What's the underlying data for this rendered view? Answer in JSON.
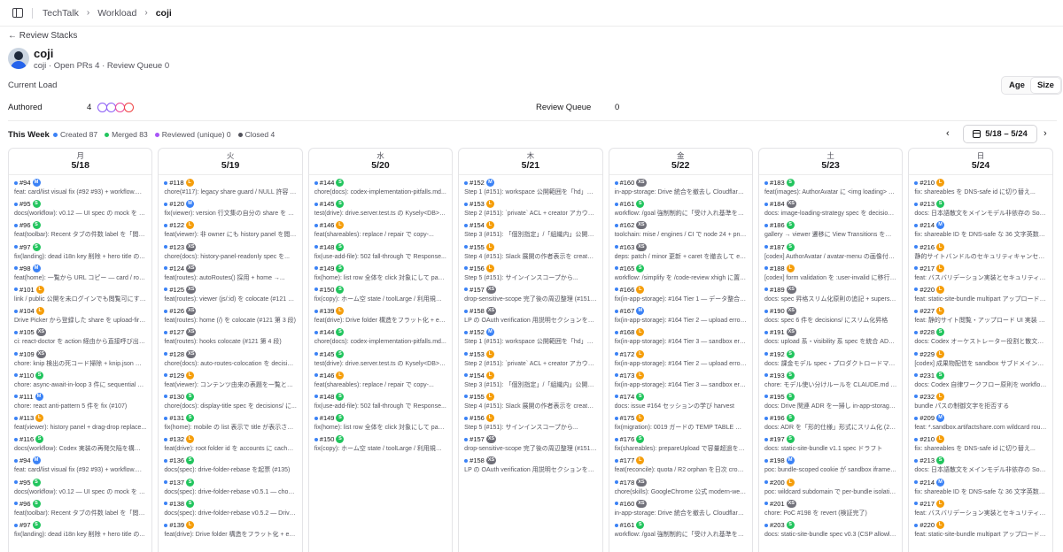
{
  "breadcrumb": {
    "items": [
      "TechTalk",
      "Workload"
    ],
    "current": "coji"
  },
  "back_label": "← Review Stacks",
  "user": {
    "name": "coji",
    "summary": "coji · Open PRs 4 · Review Queue 0"
  },
  "current_load_label": "Current Load",
  "sort_toggle": {
    "age": "Age",
    "size": "Size",
    "active": "size"
  },
  "load": {
    "authored_label": "Authored",
    "authored_count": "4",
    "circle_colors": [
      "#8b5cf6",
      "#8b5cf6",
      "#ec4899",
      "#ef4444"
    ],
    "review_label": "Review Queue",
    "review_count": "0"
  },
  "week": {
    "title": "This Week",
    "legend": [
      {
        "label": "Created 87",
        "color": "#3b82f6"
      },
      {
        "label": "Merged 83",
        "color": "#22c55e"
      },
      {
        "label": "Reviewed (unique) 0",
        "color": "#a855f7"
      },
      {
        "label": "Closed 4",
        "color": "#52525b"
      }
    ],
    "range": "5/18 – 5/24",
    "prev_icon": "chevron-left-icon",
    "next_icon": "chevron-right-icon"
  },
  "badge_colors": {
    "S": "#22c55e",
    "M": "#3b82f6",
    "L": "#f59e0b",
    "XS": "#71717a"
  },
  "days": [
    {
      "dow": "月",
      "date": "5/18",
      "items": [
        {
          "num": "#94",
          "size": "M",
          "title": "feat: card/list visual fix (#92 #93) + workflow.md..."
        },
        {
          "num": "#95",
          "size": "S",
          "title": "docs(workflow): v0.12 — UI spec の mock を dir ..."
        },
        {
          "num": "#96",
          "size": "S",
          "title": "feat(toolbar): Recent タブの件数 label を「閲覧履..."
        },
        {
          "num": "#97",
          "size": "S",
          "title": "fix(landing): dead i18n key 削除 + hero title の..."
        },
        {
          "num": "#98",
          "size": "M",
          "title": "feat(home): 一覧から URL コピー — card / row /..."
        },
        {
          "num": "#101",
          "size": "L",
          "title": "link / public 公開を未ログインでも閲覧可にする +..."
        },
        {
          "num": "#104",
          "size": "L",
          "title": "Drive Picker から登録した share を upload-first 経..."
        },
        {
          "num": "#105",
          "size": "XS",
          "title": "ci: react-doctor を action 経由から直接呼び出しに..."
        },
        {
          "num": "#109",
          "size": "XS",
          "title": "chore: knip 検出の死コード掃除 + knip.json で fals..."
        },
        {
          "num": "#110",
          "size": "S",
          "title": "chore: async-await-in-loop 3 件に sequential 意..."
        },
        {
          "num": "#111",
          "size": "M",
          "title": "chore: react anti-pattern 5 件を fix (#107)"
        },
        {
          "num": "#113",
          "size": "L",
          "title": "feat(viewer): history panel + drag-drop replace..."
        },
        {
          "num": "#116",
          "size": "S",
          "title": "docs(workflow): Codex 実装の再発欠陥を構造化..."
        },
        {
          "num": "#94",
          "size": "M",
          "title": "feat: card/list visual fix (#92 #93) + workflow.md..."
        },
        {
          "num": "#95",
          "size": "S",
          "title": "docs(workflow): v0.12 — UI spec の mock を dir ..."
        },
        {
          "num": "#96",
          "size": "S",
          "title": "feat(toolbar): Recent タブの件数 label を「閲覧履..."
        },
        {
          "num": "#97",
          "size": "S",
          "title": "fix(landing): dead i18n key 削除 + hero title の..."
        }
      ]
    },
    {
      "dow": "火",
      "date": "5/19",
      "items": [
        {
          "num": "#118",
          "size": "L",
          "title": "chore(#117): legacy share guard / NULL 許容 / f18..."
        },
        {
          "num": "#120",
          "size": "M",
          "title": "fix(viewer): version 行文集の自分の share を owne..."
        },
        {
          "num": "#122",
          "size": "L",
          "title": "feat(viewer): 非 owner にも history panel を閲覧..."
        },
        {
          "num": "#123",
          "size": "XS",
          "title": "chore(docs): history-panel-readonly spec を..."
        },
        {
          "num": "#124",
          "size": "XS",
          "title": "feat(routes): autoRoutes() 採用 + home →..."
        },
        {
          "num": "#125",
          "size": "XS",
          "title": "feat(routes): viewer (js/:id) を colocate (#121 第..."
        },
        {
          "num": "#126",
          "size": "XS",
          "title": "feat(routes): home (/) を colocate (#121 第 3 段)"
        },
        {
          "num": "#127",
          "size": "XS",
          "title": "feat(routes): hooks colocate (#121 第 4 段)"
        },
        {
          "num": "#128",
          "size": "XS",
          "title": "chore(docs): auto-routes-colocation を decision..."
        },
        {
          "num": "#129",
          "size": "L",
          "title": "feat(viewer): コンテンツ由来の表題を一覧と詳細に..."
        },
        {
          "num": "#130",
          "size": "S",
          "title": "chore(docs): display-title spec を decisions/ に..."
        },
        {
          "num": "#131",
          "size": "S",
          "title": "fix(home): mobile の list 表示で title が表示されな..."
        },
        {
          "num": "#132",
          "size": "L",
          "title": "feat(drive): root folder id を accounts に cache し..."
        },
        {
          "num": "#136",
          "size": "S",
          "title": "docs(spec): drive-folder-rebase を起票 (#135)"
        },
        {
          "num": "#137",
          "size": "S",
          "title": "docs(spec): drive-folder-rebase v0.5.1 — chore..."
        },
        {
          "num": "#138",
          "size": "S",
          "title": "docs(spec): drive-folder-rebase v0.5.2 — Drive..."
        },
        {
          "num": "#139",
          "size": "L",
          "title": "feat(drive): Drive folder 構造をフラット化 + env-..."
        }
      ]
    },
    {
      "dow": "水",
      "date": "5/20",
      "items": [
        {
          "num": "#144",
          "size": "S",
          "title": "chore(docs): codex-implementation-pitfalls.md..."
        },
        {
          "num": "#145",
          "size": "S",
          "title": "test(drive): drive.server.test.ts の Kysely<DB> ニ..."
        },
        {
          "num": "#146",
          "size": "L",
          "title": "feat(shareables): replace / repair で copy-..."
        },
        {
          "num": "#148",
          "size": "S",
          "title": "fix(use-add-file): 502 fall-through で Response..."
        },
        {
          "num": "#149",
          "size": "S",
          "title": "fix(home): list row 全体を click 対象にして paddin..."
        },
        {
          "num": "#150",
          "size": "S",
          "title": "fix(copy): ホーム空 state / toolLarge / 利用規約 / フ..."
        },
        {
          "num": "#139",
          "size": "L",
          "title": "feat(drive): Drive folder 構造をフラット化 + env-..."
        },
        {
          "num": "#144",
          "size": "S",
          "title": "chore(docs): codex-implementation-pitfalls.md..."
        },
        {
          "num": "#145",
          "size": "S",
          "title": "test(drive): drive.server.test.ts の Kysely<DB> ニ..."
        },
        {
          "num": "#146",
          "size": "L",
          "title": "feat(shareables): replace / repair で copy-..."
        },
        {
          "num": "#148",
          "size": "S",
          "title": "fix(use-add-file): 502 fall-through で Response..."
        },
        {
          "num": "#149",
          "size": "S",
          "title": "fix(home): list row 全体を click 対象にして paddin..."
        },
        {
          "num": "#150",
          "size": "S",
          "title": "fix(copy): ホーム空 state / toolLarge / 利用規約 / フ..."
        }
      ]
    },
    {
      "dow": "木",
      "date": "5/21",
      "items": [
        {
          "num": "#152",
          "size": "M",
          "title": "Step 1 (#151): workspace 公開範囲を「hd」ベース..."
        },
        {
          "num": "#153",
          "size": "L",
          "title": "Step 2 (#151): `private` ACL + creator アカウント..."
        },
        {
          "num": "#154",
          "size": "L",
          "title": "Step 3 (#151): 「個別指定」/「組織内」公開範囲の..."
        },
        {
          "num": "#155",
          "size": "L",
          "title": "Step 4 (#151): Slack 展開の作者表示を creator の..."
        },
        {
          "num": "#156",
          "size": "L",
          "title": "Step 5 (#151): サインインスコープから..."
        },
        {
          "num": "#157",
          "size": "XS",
          "title": "drop-sensitive-scope 完了後の周辺整理 (#151 tidy..."
        },
        {
          "num": "#158",
          "size": "XS",
          "title": "LP の OAuth verification 用説明セクションを撤去"
        },
        {
          "num": "#152",
          "size": "M",
          "title": "Step 1 (#151): workspace 公開範囲を「hd」ベース..."
        },
        {
          "num": "#153",
          "size": "L",
          "title": "Step 2 (#151): `private` ACL + creator アカウント..."
        },
        {
          "num": "#154",
          "size": "L",
          "title": "Step 3 (#151): 「個別指定」/「組織内」公開範囲の..."
        },
        {
          "num": "#155",
          "size": "L",
          "title": "Step 4 (#151): Slack 展開の作者表示を creator の..."
        },
        {
          "num": "#156",
          "size": "L",
          "title": "Step 5 (#151): サインインスコープから..."
        },
        {
          "num": "#157",
          "size": "XS",
          "title": "drop-sensitive-scope 完了後の周辺整理 (#151 tidy..."
        },
        {
          "num": "#158",
          "size": "XS",
          "title": "LP の OAuth verification 用説明セクションを撤去"
        }
      ]
    },
    {
      "dow": "金",
      "date": "5/22",
      "items": [
        {
          "num": "#160",
          "size": "XS",
          "title": "in-app-storage: Drive 統合を撤去し Cloudflare R2..."
        },
        {
          "num": "#161",
          "size": "S",
          "title": "workflow: /goal 強制制約に「受け入れ基準を書き換..."
        },
        {
          "num": "#162",
          "size": "XS",
          "title": "toolchain: mise / engines / CI で node 24 + pnpm..."
        },
        {
          "num": "#163",
          "size": "XS",
          "title": "deps: patch / minor 更新 + caret を撤去して exact..."
        },
        {
          "num": "#165",
          "size": "S",
          "title": "workflow: /simplify を /code-review xhigh に置換..."
        },
        {
          "num": "#166",
          "size": "L",
          "title": "fix(in-app-storage): #164 Tier 1 — データ整合性..."
        },
        {
          "num": "#167",
          "size": "M",
          "title": "fix(in-app-storage): #164 Tier 2 — upload error ..."
        },
        {
          "num": "#168",
          "size": "L",
          "title": "fix(in-app-storage): #164 Tier 3 — sandbox error..."
        },
        {
          "num": "#172",
          "size": "L",
          "title": "fix(in-app-storage): #164 Tier 2 — upload error ..."
        },
        {
          "num": "#173",
          "size": "L",
          "title": "fix(in-app-storage): #164 Tier 3 — sandbox error..."
        },
        {
          "num": "#174",
          "size": "S",
          "title": "docs: issue #164 セッションの学び harvest"
        },
        {
          "num": "#175",
          "size": "L",
          "title": "fix(migration): 0019 ガードの TEMP TABLE 除去 +..."
        },
        {
          "num": "#176",
          "size": "S",
          "title": "fix(shareables): prepareUpload で容量超過を先に..."
        },
        {
          "num": "#177",
          "size": "L",
          "title": "feat(reconcile): quota / R2 orphan を日次 cron で..."
        },
        {
          "num": "#178",
          "size": "XS",
          "title": "chore(skills): GoogleChrome 公式 modern-web-..."
        },
        {
          "num": "#160",
          "size": "XS",
          "title": "in-app-storage: Drive 統合を撤去し Cloudflare R2..."
        },
        {
          "num": "#161",
          "size": "S",
          "title": "workflow: /goal 強制制約に「受け入れ基準を書き換..."
        }
      ]
    },
    {
      "dow": "土",
      "date": "5/23",
      "items": [
        {
          "num": "#183",
          "size": "S",
          "title": "feat(images): AuthorAvatar に <img loading> 戦略..."
        },
        {
          "num": "#184",
          "size": "XS",
          "title": "docs: image-loading-strategy spec を decisions/..."
        },
        {
          "num": "#186",
          "size": "S",
          "title": "gallery → viewer 遷移に View Transitions を導入す..."
        },
        {
          "num": "#187",
          "size": "S",
          "title": "[codex] AuthorAvatar / avatar-menu の画像付き..."
        },
        {
          "num": "#188",
          "size": "L",
          "title": "[codex] form validation を :user-invalid に移行する"
        },
        {
          "num": "#189",
          "size": "XS",
          "title": "docs: spec 昇格スリム化原則の追記 + supersedeid..."
        },
        {
          "num": "#190",
          "size": "XS",
          "title": "docs: spec 6 件を decisions/ にスリム化昇格"
        },
        {
          "num": "#191",
          "size": "XS",
          "title": "docs: upload 系・visibility 系 spec を統合 ADR に..."
        },
        {
          "num": "#192",
          "size": "S",
          "title": "docs: 課金モデル spec・プロダクトロードマップ・..."
        },
        {
          "num": "#193",
          "size": "S",
          "title": "chore: モデル使い分けルールを CLAUDE.md に追加"
        },
        {
          "num": "#195",
          "size": "S",
          "title": "docs: Drive 関連 ADR を一掃し in-app-storage を..."
        },
        {
          "num": "#196",
          "size": "S",
          "title": "docs: ADR を「形的仕様」形式にスリム化 (2024仕..."
        },
        {
          "num": "#197",
          "size": "S",
          "title": "docs: static-site-bundle v1.1 spec ドラフト"
        },
        {
          "num": "#198",
          "size": "M",
          "title": "poc: bundle-scoped cookie が sandbox iframe で..."
        },
        {
          "num": "#200",
          "size": "L",
          "title": "poc: wildcard subdomain で per-bundle isolation..."
        },
        {
          "num": "#201",
          "size": "XS",
          "title": "chore: PoC #198 を revert (検証完了)"
        },
        {
          "num": "#203",
          "size": "S",
          "title": "docs: static-site-bundle spec v0.3 (CSP allowlist..."
        }
      ]
    },
    {
      "dow": "日",
      "date": "5/24",
      "items": [
        {
          "num": "#210",
          "size": "L",
          "title": "fix: shareables を DNS-safe id に切り替え..."
        },
        {
          "num": "#213",
          "size": "S",
          "title": "docs: 日本語散文をメインモデル非依存の Sonnet ..."
        },
        {
          "num": "#214",
          "size": "M",
          "title": "fix: shareable ID を DNS-safe な 36 文字英数字 ID..."
        },
        {
          "num": "#216",
          "size": "L",
          "title": "静的サイトバンドルのセキュリティキャンセリュー..."
        },
        {
          "num": "#217",
          "size": "L",
          "title": "feat: バスバリデーション実装とセキュリティモジュー..."
        },
        {
          "num": "#220",
          "size": "L",
          "title": "feat: static-site-bundle multipart アップロード実装"
        },
        {
          "num": "#227",
          "size": "L",
          "title": "feat: 静的サイト閲覧・アップロード UI 実装 (#208)"
        },
        {
          "num": "#228",
          "size": "S",
          "title": "docs: Codex オーケストレーター役割と散文表現ルール..."
        },
        {
          "num": "#229",
          "size": "L",
          "title": "[codex] 成果物配信を sandbox サブドメインに統一..."
        },
        {
          "num": "#231",
          "size": "S",
          "title": "docs: Codex 自律ワークフロー原則を workflow.md に..."
        },
        {
          "num": "#232",
          "size": "L",
          "title": "bundle パスの制御文字を拒否する"
        },
        {
          "num": "#209",
          "size": "M",
          "title": "feat: *.sandbox.artifactshare.com wildcard route..."
        },
        {
          "num": "#210",
          "size": "L",
          "title": "fix: shareables を DNS-safe id に切り替え..."
        },
        {
          "num": "#213",
          "size": "S",
          "title": "docs: 日本語散文をメインモデル非依存の Sonnet ..."
        },
        {
          "num": "#214",
          "size": "M",
          "title": "fix: shareable ID を DNS-safe な 36 文字英数字 ID..."
        },
        {
          "num": "#217",
          "size": "L",
          "title": "feat: バスバリデーション実装とセキュリティモジュー..."
        },
        {
          "num": "#220",
          "size": "L",
          "title": "feat: static-site-bundle multipart アップロード実装"
        }
      ]
    }
  ]
}
